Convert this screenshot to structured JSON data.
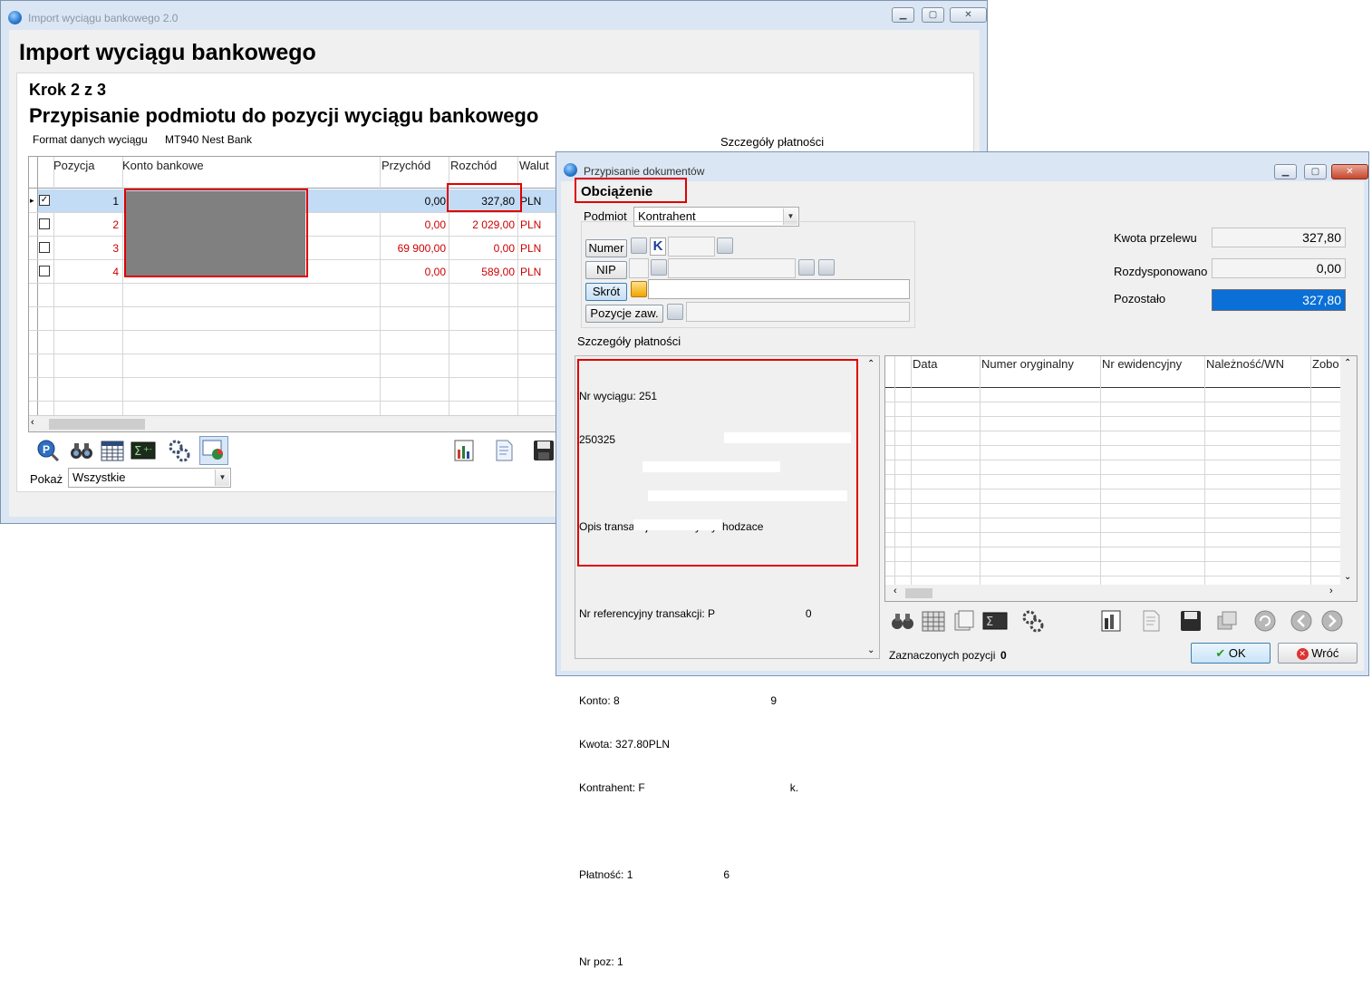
{
  "colors": {
    "error_red": "#cc0000",
    "highlight_box": "#e00000",
    "selection_blue": "#c3dcf5",
    "accent_blue": "#0a6fd7"
  },
  "main_window": {
    "title": "Import wyciągu bankowego 2.0",
    "heading": "Import wyciągu bankowego",
    "step": "Krok 2 z 3",
    "subtitle": "Przypisanie podmiotu do pozycji wyciągu bankowego",
    "format_label": "Format danych wyciągu",
    "format_value": "MT940 Nest Bank",
    "details_label": "Szczegóły płatności",
    "columns": [
      "Pozycja",
      "Konto bankowe",
      "Przychód",
      "Rozchód",
      "Walut"
    ],
    "rows": [
      {
        "pozycja": "1",
        "przychod": "0,00",
        "rozchod": "327,80",
        "waluta": "PLN",
        "checked": true,
        "selected": true
      },
      {
        "pozycja": "2",
        "przychod": "0,00",
        "rozchod": "2 029,00",
        "waluta": "PLN",
        "checked": false,
        "selected": false
      },
      {
        "pozycja": "3",
        "przychod": "69 900,00",
        "rozchod": "0,00",
        "waluta": "PLN",
        "checked": false,
        "selected": false
      },
      {
        "pozycja": "4",
        "przychod": "0,00",
        "rozchod": "589,00",
        "waluta": "PLN",
        "checked": false,
        "selected": false
      }
    ],
    "show_label": "Pokaż",
    "show_value": "Wszystkie",
    "toolbar_icons": [
      "search-p-icon",
      "binoculars-icon",
      "grid-table-icon",
      "sigma-calc-icon",
      "gears-icon",
      "chart-window-icon",
      "report-icon",
      "document-icon",
      "save-icon"
    ]
  },
  "dialog": {
    "title": "Przypisanie dokumentów",
    "type_label": "Obciążenie",
    "podmiot_label": "Podmiot",
    "podmiot_value": "Kontrahent",
    "numer_button": "Numer",
    "k_label": "K",
    "nip_button": "NIP",
    "skrot_button": "Skrót",
    "pozycje_button": "Pozycje zaw.",
    "kwota_label": "Kwota przelewu",
    "kwota_value": "327,80",
    "rozdysponowano_label": "Rozdysponowano",
    "rozdysponowano_value": "0,00",
    "pozostalo_label": "Pozostało",
    "pozostalo_value": "327,80",
    "details_label": "Szczegóły płatności",
    "details_lines": [
      "Nr wyciągu: 251",
      "250325",
      "",
      "Opis transakcji: Przelewy wychodzace",
      "",
      "Nr referencyjny transakcji: P                              0",
      "",
      "Konto: 8                                                  9",
      "Kwota: 327.80PLN",
      "Kontrahent: F                                                k.",
      "",
      "Płatność: 1                              6",
      "",
      "Nr poz: 1"
    ],
    "doc_columns": [
      "Data",
      "Numer oryginalny",
      "Nr ewidencyjny",
      "Należność/WN",
      "Zobo"
    ],
    "selected_label": "Zaznaczonych pozycji",
    "selected_count": "0",
    "ok_button": "OK",
    "back_button": "Wróć",
    "toolbar_icons": [
      "binoculars-icon",
      "grid-table-icon",
      "documents-icon",
      "sigma-calc-icon",
      "gears-icon",
      "report-icon",
      "document-icon",
      "save-icon",
      "copy-icon",
      "refresh-icon",
      "prev-icon",
      "next-icon"
    ]
  }
}
